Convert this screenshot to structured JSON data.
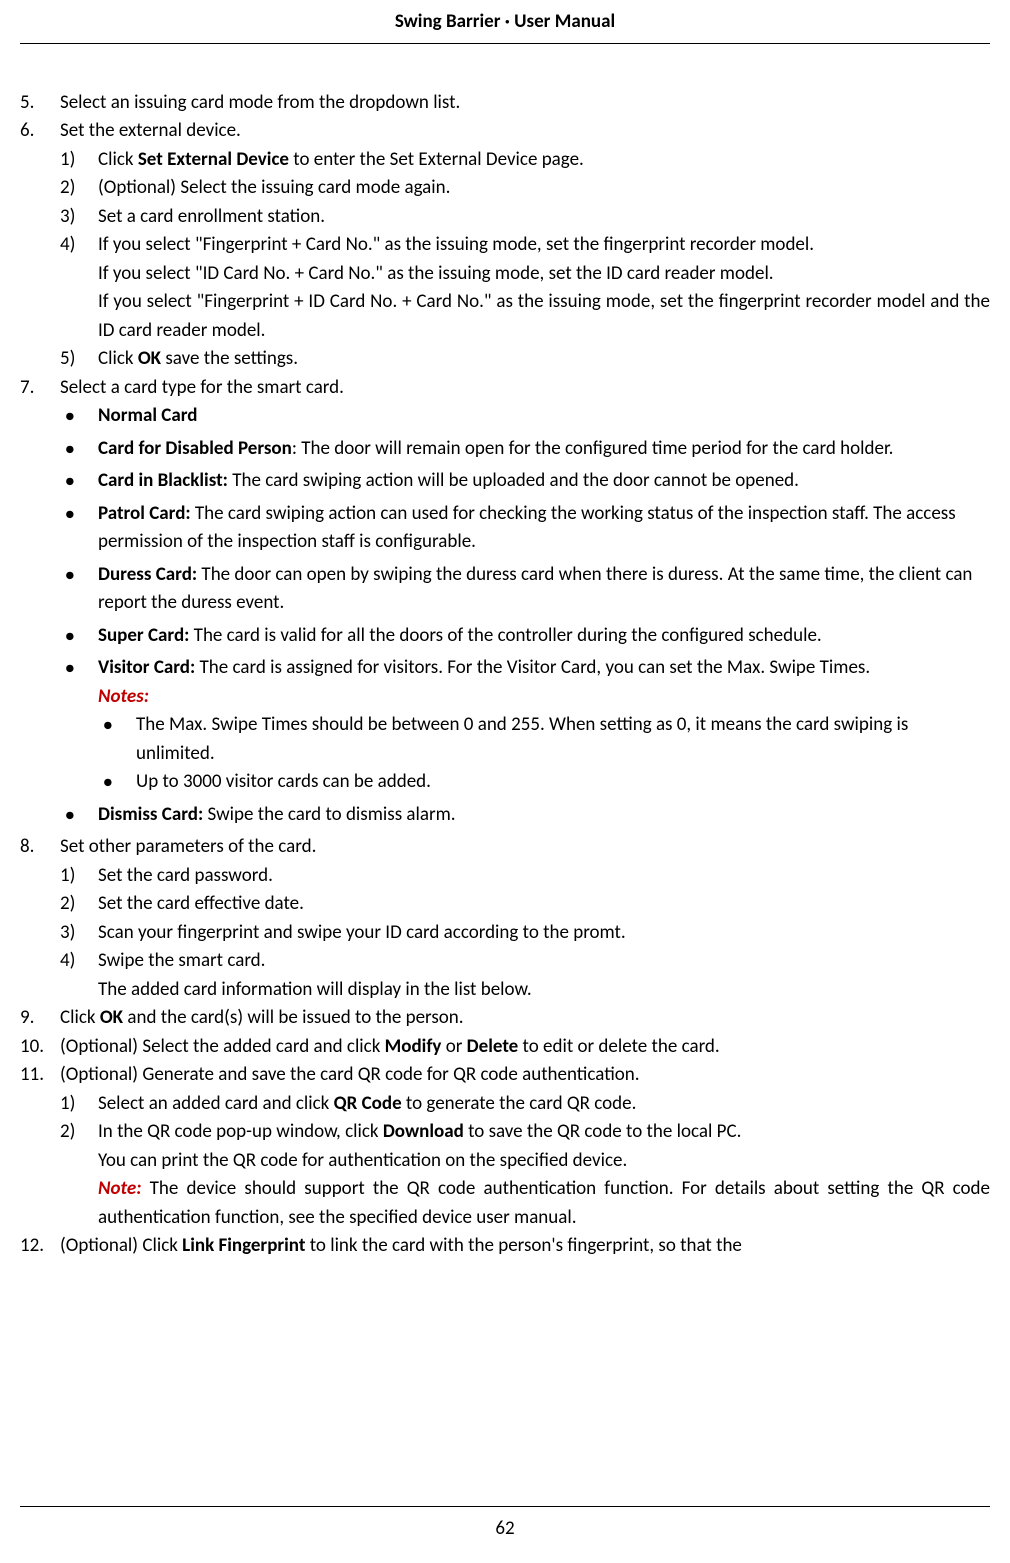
{
  "header": {
    "title": "Swing Barrier · User Manual"
  },
  "footer": {
    "page": "62"
  },
  "items": {
    "i5": "Select an issuing card mode from the dropdown list.",
    "i6": "Set the external device.",
    "i6_sub": {
      "s1": "Click ",
      "s1_bold": "Set External Device",
      "s1_after": " to enter the Set External Device page.",
      "s2": "(Optional) Select the issuing card mode again.",
      "s3": "Set a card enrollment station.",
      "s4": "If you select \"Fingerprint + Card No.\" as the issuing mode, set the fingerprint recorder model.",
      "s4_cont1": "If you select \"ID Card No. + Card No.\" as the issuing mode, set the ID card reader model.",
      "s4_cont2": "If you select \"Fingerprint + ID Card No. + Card No.\" as the issuing mode, set the fingerprint recorder model and the ID card reader model.",
      "s5": "Click ",
      "s5_bold": "OK",
      "s5_after": " save the settings."
    },
    "i7": "Select a card type for the smart card.",
    "i7_bullets": {
      "b1": "Normal Card",
      "b2_bold": "Card for Disabled Person",
      "b2_text": ": The door will remain open for the configured time period for the card holder.",
      "b3_bold": "Card in Blacklist:",
      "b3_text": " The card swiping action will be uploaded and the door cannot be opened.",
      "b4_bold": "Patrol Card:",
      "b4_text": " The card swiping action can used for checking the working status of the inspection staff. The access permission of the inspection staff is configurable.",
      "b5_bold": "Duress Card:",
      "b5_text": " The door can open by swiping the duress card when there is duress. At the same time, the client can report the duress event.",
      "b6_bold": "Super Card:",
      "b6_text": " The card is valid for all the doors of the controller during the configured schedule.",
      "b7_bold": "Visitor Card:",
      "b7_text": " The card is assigned for visitors. For the Visitor Card, you can set the Max. Swipe Times.",
      "notes_label": "Notes:",
      "note1": "The Max. Swipe Times should be between 0 and 255. When setting as 0, it means the card swiping is unlimited.",
      "note2": "Up to 3000 visitor cards can be added.",
      "b8_bold": "Dismiss Card:",
      "b8_text": " Swipe the card to dismiss alarm."
    },
    "i8": "Set other parameters of the card.",
    "i8_sub": {
      "s1": "Set the card password.",
      "s2": "Set the card effective date.",
      "s3": "Scan your fingerprint and swipe your ID card according to the promt.",
      "s4": "Swipe the smart card.",
      "s4_cont": "The added card information will display in the list below."
    },
    "i9_pre": "Click ",
    "i9_bold": "OK",
    "i9_after": " and the card(s) will be issued to the person.",
    "i10_pre": "(Optional) Select the added card and click ",
    "i10_bold1": "Modify",
    "i10_mid": " or ",
    "i10_bold2": "Delete",
    "i10_after": " to edit or delete the card.",
    "i11": "(Optional) Generate and save the card QR code for QR code authentication.",
    "i11_sub": {
      "s1_pre": "Select an added card and click ",
      "s1_bold": "QR Code",
      "s1_after": " to generate the card QR code.",
      "s2_pre": "In the QR code pop-up window, click ",
      "s2_bold": "Download",
      "s2_after": " to save the QR code to the local PC.",
      "s2_cont": "You can print the QR code for authentication on the specified device.",
      "s2_note_label": "Note:",
      "s2_note_text": " The device should support the QR code authentication function. For details about setting the QR code authentication function, see the specified device user manual."
    },
    "i12_pre": "(Optional) Click ",
    "i12_bold": "Link Fingerprint",
    "i12_after": " to link the card with the person's fingerprint, so that the"
  }
}
